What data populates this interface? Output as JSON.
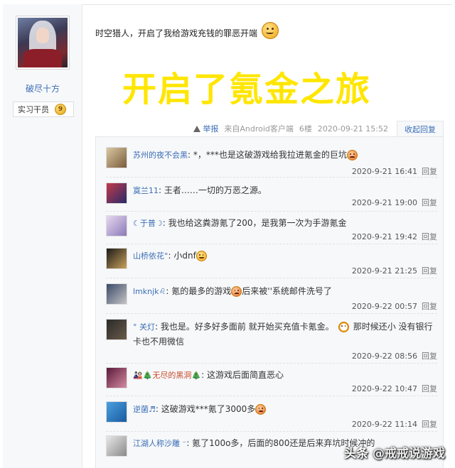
{
  "author": {
    "name": "破尽十方",
    "rank_label": "实习干员",
    "rank_level": "9"
  },
  "post": {
    "text": "时空猎人，开启了我给游戏充钱的罪恶开端",
    "big_title": "开启了氪金之旅",
    "report_label": "举报",
    "source": "来自Android客户端",
    "floor": "6楼",
    "timestamp": "2020-09-21 15:52",
    "collapse_label": "收起回复"
  },
  "replies": [
    {
      "name": "苏州的夜不会黑",
      "sep": ": ",
      "text": "*，***也是这破游戏给我拉进氪金的巨坑",
      "emoji": "angry",
      "time": "2020-9-21 16:41",
      "reply_label": "回复"
    },
    {
      "name": "寞兰11",
      "sep": ": ",
      "text": "王者……一切的万恶之源。",
      "emoji": "",
      "time": "2020-9-21 19:00",
      "reply_label": "回复"
    },
    {
      "name": "☾于普☽",
      "sep": ": ",
      "text": "我也给这粪游氪了200，是我第一次为手游氪金",
      "emoji": "",
      "time": "2020-9-21 19:42",
      "reply_label": "回复"
    },
    {
      "name": "山桥依花°",
      "sep": ": ",
      "text": "小dnf",
      "emoji": "smile",
      "time": "2020-9-21 21:25",
      "reply_label": "回复"
    },
    {
      "name": "lmknjk♌",
      "sep": ": ",
      "text": "氪的最多的游戏",
      "emoji": "angry",
      "text2": "后来被''系统邮件洗号了",
      "time": "2020-9-22 00:57",
      "reply_label": "回复"
    },
    {
      "name": "° 关灯",
      "sep": ": ",
      "text": "我也是。好多好多面前 就开始买充值卡氪金。",
      "emoji": "clock",
      "text2": "那时候还小 没有银行卡也不用微信",
      "time": "2020-9-22 08:56",
      "reply_label": "回复"
    },
    {
      "name": "🎎🎄无尽的黑洞🎄",
      "sep": ": ",
      "text": "这游戏后面简直恶心",
      "emoji": "",
      "time": "2020-9-22 10:47",
      "reply_label": "回复"
    },
    {
      "name": "逆菌♬",
      "sep": ": ",
      "text": "这破游戏***氪了3000多",
      "emoji": "angry",
      "time": "2020-9-22 11:14",
      "reply_label": "回复"
    },
    {
      "name": "江湖人称沙雕 ⁻",
      "sep": ": ",
      "text": "氪了100o多，后面的800还是后来弃坑时候冲的",
      "emoji": "",
      "time": "",
      "reply_label": ""
    }
  ],
  "watermark": {
    "platform": "头条",
    "handle": "@戒戒说游戏"
  },
  "colors": {
    "link_blue": "#3a6eb5",
    "title_yellow": "#ffe600",
    "reply_bg": "#f7f8fa"
  }
}
